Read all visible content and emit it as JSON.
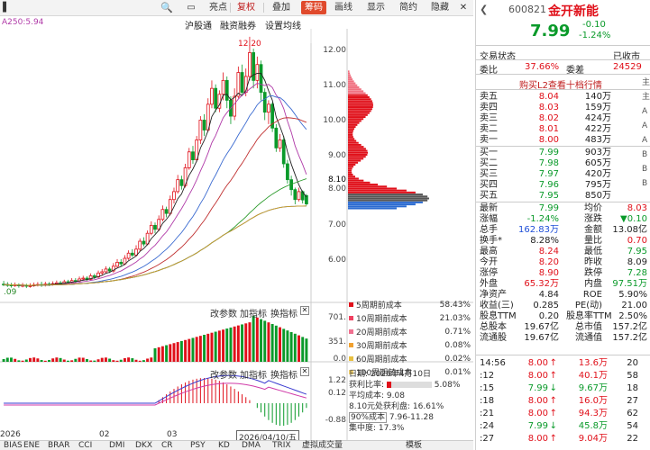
{
  "toolbar": {
    "items": [
      "亮点",
      "复权",
      "叠加",
      "筹码",
      "画线",
      "显示",
      "简约",
      "隐藏"
    ],
    "active": "筹码"
  },
  "ma_legend": "A250:5.94",
  "overlay": {
    "items": [
      "沪股通",
      "融资融券",
      "设置均线"
    ]
  },
  "price_axis": {
    "labels": [
      "12.00",
      "11.00",
      "10.00",
      "9.00",
      "8.00",
      "7.00",
      "6.00"
    ],
    "highlight": [
      "8.10",
      "8.10"
    ]
  },
  "annotations": {
    "high": "12.20",
    "low": ".09"
  },
  "volume_axis": [
    "701.",
    "351.",
    "0.0"
  ],
  "macd_axis": [
    "1.22",
    "0.12",
    "-0.88"
  ],
  "panel_controls": {
    "change": "改参数",
    "add": "加指标",
    "switch": "换指标"
  },
  "dates": {
    "m1": "2026",
    "m2": "02",
    "m3": "03",
    "cur": "2026/04/10/五"
  },
  "chip_dist": {
    "rows": [
      {
        "label": "5周期前成本",
        "pct": "58.43%",
        "color": "#e0101a"
      },
      {
        "label": "10周期前成本",
        "pct": "21.03%",
        "color": "#f04060"
      },
      {
        "label": "20周期前成本",
        "pct": "0.71%",
        "color": "#f07090"
      },
      {
        "label": "30周期前成本",
        "pct": "0.08%",
        "color": "#f0a030"
      },
      {
        "label": "60周期前成本",
        "pct": "0.02%",
        "color": "#e8c040"
      },
      {
        "label": "100周期前成本",
        "pct": "0.01%",
        "color": "#f0d070"
      }
    ]
  },
  "chip_info": {
    "date": "日期: 2026年4月10日",
    "profit_label": "获利比率:",
    "profit_val": "5.08%",
    "avg": "平均成本: 9.08",
    "profit_at": "8.10元处获利盘: 16.61%",
    "cost_label": "90%成本",
    "cost_range": "7.96-11.28",
    "conc": "集中度: 17.3%"
  },
  "bottom_tabs": [
    "BIAS",
    "ENE",
    "BRAR",
    "CCI",
    "DMI",
    "DKX",
    "CR",
    "PSY",
    "KD",
    "DMA",
    "TRIX",
    "虚拟成交量",
    "模板"
  ],
  "stock": {
    "code": "600821",
    "name": "金开新能",
    "price": "7.99",
    "change": "-0.10",
    "pct": "-1.24%",
    "status_label": "交易状态",
    "status": "已收市"
  },
  "ratio": {
    "wb_label": "委比",
    "wb": "37.66%",
    "wc_label": "委差",
    "wc": "24529"
  },
  "l2_link": "购买L2查看十档行情",
  "asks": [
    [
      "卖五",
      "8.04",
      "140万"
    ],
    [
      "卖四",
      "8.03",
      "159万"
    ],
    [
      "卖三",
      "8.02",
      "424万"
    ],
    [
      "卖二",
      "8.01",
      "422万"
    ],
    [
      "卖一",
      "8.00",
      "483万"
    ]
  ],
  "bids": [
    [
      "买一",
      "7.99",
      "903万"
    ],
    [
      "买二",
      "7.98",
      "605万"
    ],
    [
      "买三",
      "7.97",
      "420万"
    ],
    [
      "买四",
      "7.96",
      "795万"
    ],
    [
      "买五",
      "7.95",
      "850万"
    ]
  ],
  "stats": [
    [
      "最新",
      "7.99",
      "均价",
      "8.03"
    ],
    [
      "涨幅",
      "-1.24%",
      "涨跌",
      "▼0.10"
    ],
    [
      "总手",
      "162.83万",
      "金额",
      "13.08亿"
    ],
    [
      "换手*",
      "8.28%",
      "量比",
      "0.70"
    ],
    [
      "最高",
      "8.24",
      "最低",
      "7.95"
    ],
    [
      "今开",
      "8.20",
      "昨收",
      "8.09"
    ],
    [
      "涨停",
      "8.90",
      "跌停",
      "7.28"
    ],
    [
      "外盘",
      "65.32万",
      "内盘",
      "97.51万"
    ],
    [
      "净资产",
      "4.84",
      "ROE",
      "5.90%"
    ],
    [
      "收益(三)",
      "0.285",
      "PE(动)",
      "21.00"
    ],
    [
      "股息TTM",
      "0.20",
      "股息率TTM",
      "2.50%"
    ],
    [
      "总股本",
      "19.67亿",
      "总市值",
      "157.2亿"
    ],
    [
      "流通股",
      "19.67亿",
      "流通值",
      "157.2亿"
    ]
  ],
  "ticks": [
    [
      "14:56",
      "8.00",
      "↑",
      "13.6万",
      "20"
    ],
    [
      ":12",
      "8.00",
      "↑",
      "40.1万",
      "58"
    ],
    [
      ":15",
      "7.99",
      "↓",
      "9.67万",
      "18"
    ],
    [
      ":18",
      "8.00",
      "↑",
      "16.0万",
      "27"
    ],
    [
      ":21",
      "8.00",
      "↑",
      "94.3万",
      "62"
    ],
    [
      ":24",
      "7.99",
      "↓",
      "45.8万",
      "54"
    ],
    [
      ":27",
      "8.00",
      "↑",
      "9.04万",
      "22"
    ]
  ],
  "right_strip": [
    "主",
    "主",
    "A",
    "A",
    "A",
    "B",
    "B",
    "B"
  ],
  "chart_data": {
    "type": "candlestick",
    "ylim": [
      5.6,
      12.4
    ],
    "candles": [
      [
        5.97,
        5.96,
        6.05,
        5.92
      ],
      [
        5.96,
        5.95,
        6.02,
        5.9
      ],
      [
        5.95,
        5.94,
        6.0,
        5.88
      ],
      [
        5.94,
        5.95,
        6.01,
        5.9
      ],
      [
        5.95,
        5.93,
        5.99,
        5.88
      ],
      [
        5.93,
        5.94,
        6.0,
        5.89
      ],
      [
        5.94,
        5.92,
        5.98,
        5.87
      ],
      [
        5.92,
        5.93,
        5.99,
        5.88
      ],
      [
        5.93,
        5.95,
        6.01,
        5.9
      ],
      [
        5.95,
        5.96,
        6.02,
        5.91
      ],
      [
        5.96,
        5.95,
        6.03,
        5.9
      ],
      [
        5.95,
        5.97,
        6.03,
        5.91
      ],
      [
        5.97,
        5.96,
        6.02,
        5.92
      ],
      [
        5.96,
        5.98,
        6.04,
        5.93
      ],
      [
        5.98,
        6.0,
        6.06,
        5.95
      ],
      [
        6.0,
        5.99,
        6.05,
        5.94
      ],
      [
        5.99,
        6.03,
        6.08,
        5.96
      ],
      [
        6.03,
        6.02,
        6.08,
        5.98
      ],
      [
        6.02,
        6.06,
        6.12,
        5.99
      ],
      [
        6.06,
        6.05,
        6.12,
        6.0
      ],
      [
        6.05,
        6.1,
        6.16,
        6.02
      ],
      [
        6.1,
        6.12,
        6.18,
        6.06
      ],
      [
        6.12,
        6.09,
        6.17,
        6.05
      ],
      [
        6.09,
        6.18,
        6.24,
        6.06
      ],
      [
        6.18,
        6.15,
        6.23,
        6.1
      ],
      [
        6.15,
        6.25,
        6.31,
        6.12
      ],
      [
        6.25,
        6.28,
        6.35,
        6.2
      ],
      [
        6.28,
        6.35,
        6.42,
        6.25
      ],
      [
        6.35,
        6.3,
        6.4,
        6.25
      ],
      [
        6.3,
        6.42,
        6.5,
        6.26
      ],
      [
        6.42,
        6.52,
        6.6,
        6.38
      ],
      [
        6.52,
        6.48,
        6.6,
        6.42
      ],
      [
        6.48,
        6.62,
        6.7,
        6.45
      ],
      [
        6.62,
        6.75,
        6.82,
        6.58
      ],
      [
        6.75,
        6.7,
        6.85,
        6.65
      ],
      [
        6.7,
        6.85,
        6.95,
        6.66
      ],
      [
        6.85,
        7.05,
        7.12,
        6.8
      ],
      [
        7.05,
        6.98,
        7.15,
        6.92
      ],
      [
        6.98,
        7.25,
        7.32,
        6.95
      ],
      [
        7.25,
        7.45,
        7.55,
        7.2
      ],
      [
        7.45,
        7.35,
        7.52,
        7.25
      ],
      [
        7.35,
        7.6,
        7.7,
        7.3
      ],
      [
        7.6,
        7.85,
        7.95,
        7.55
      ],
      [
        7.85,
        7.75,
        7.92,
        7.65
      ],
      [
        7.75,
        8.1,
        8.2,
        7.7
      ],
      [
        8.1,
        8.3,
        8.4,
        8.0
      ],
      [
        8.3,
        8.6,
        8.72,
        8.25
      ],
      [
        8.6,
        8.45,
        8.7,
        8.35
      ],
      [
        8.45,
        8.9,
        9.0,
        8.4
      ],
      [
        8.9,
        9.3,
        9.4,
        8.85
      ],
      [
        9.3,
        9.1,
        9.45,
        9.0
      ],
      [
        9.1,
        9.6,
        9.7,
        9.05
      ],
      [
        9.6,
        10.1,
        10.2,
        9.5
      ],
      [
        10.1,
        9.85,
        10.25,
        9.7
      ],
      [
        9.85,
        10.5,
        10.65,
        9.8
      ],
      [
        10.5,
        10.9,
        11.1,
        10.4
      ],
      [
        10.9,
        10.4,
        11.0,
        10.3
      ],
      [
        10.4,
        10.75,
        10.85,
        10.3
      ],
      [
        10.75,
        11.1,
        11.3,
        10.6
      ],
      [
        11.1,
        10.6,
        11.2,
        10.4
      ],
      [
        10.6,
        10.2,
        10.7,
        10.0
      ],
      [
        10.2,
        10.7,
        10.9,
        10.1
      ],
      [
        10.7,
        11.3,
        11.45,
        10.65
      ],
      [
        11.3,
        10.8,
        11.5,
        10.7
      ],
      [
        10.8,
        11.2,
        11.4,
        10.7
      ],
      [
        11.2,
        11.8,
        12.2,
        11.1
      ],
      [
        11.8,
        11.1,
        11.9,
        10.9
      ],
      [
        11.1,
        11.5,
        11.7,
        10.9
      ],
      [
        11.5,
        10.8,
        11.6,
        10.6
      ],
      [
        10.8,
        10.3,
        10.9,
        10.1
      ],
      [
        10.3,
        10.5,
        10.6,
        10.0
      ],
      [
        10.5,
        9.9,
        10.55,
        9.8
      ],
      [
        9.9,
        9.4,
        10.0,
        9.3
      ],
      [
        9.4,
        9.6,
        9.75,
        9.3
      ],
      [
        9.6,
        9.0,
        9.7,
        8.9
      ],
      [
        9.0,
        8.6,
        9.1,
        8.5
      ],
      [
        8.6,
        8.35,
        8.7,
        8.2
      ],
      [
        8.35,
        8.1,
        8.4,
        7.98
      ],
      [
        8.1,
        8.3,
        8.4,
        8.05
      ],
      [
        8.3,
        8.09,
        8.33,
        8.0
      ],
      [
        8.2,
        7.99,
        8.24,
        7.95
      ]
    ]
  }
}
